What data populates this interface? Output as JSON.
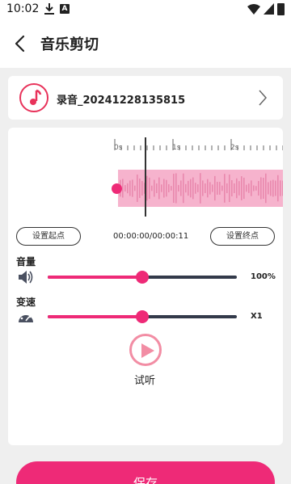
{
  "status_bar": {
    "time": "10:02"
  },
  "header": {
    "title": "音乐剪切"
  },
  "file": {
    "name": "录音_20241228135815"
  },
  "timeline": {
    "ticks": [
      "0s",
      "1s",
      "2s"
    ]
  },
  "trim": {
    "set_start_label": "设置起点",
    "set_end_label": "设置终点",
    "time_readout": "00:00:00/00:00:11"
  },
  "volume": {
    "label": "音量",
    "value_text": "100%",
    "level": 0.5
  },
  "speed": {
    "label": "变速",
    "value_text": "X1",
    "level": 0.5
  },
  "preview": {
    "label": "试听"
  },
  "footer": {
    "save_label": "保存"
  },
  "colors": {
    "accent": "#ee2a77",
    "waveform": "#f6b3cd",
    "track": "#333a4a"
  }
}
